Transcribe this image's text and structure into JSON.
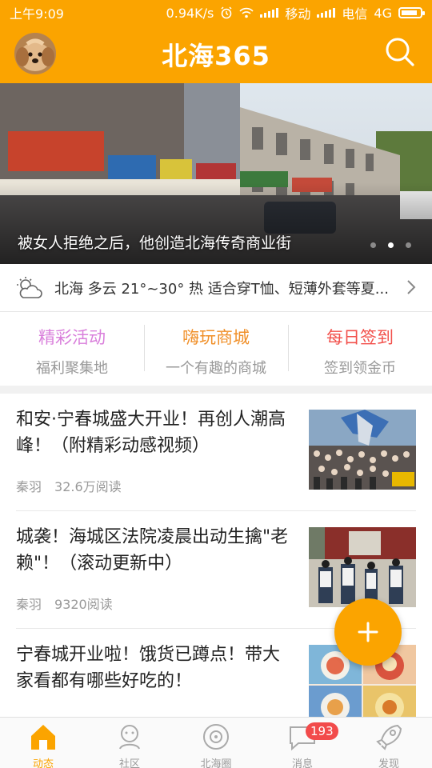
{
  "status_bar": {
    "time": "上午9:09",
    "speed": "0.94K/s",
    "carrier1": "移动",
    "carrier2": "电信",
    "network": "4G",
    "battery_level": 0.85
  },
  "header": {
    "title": "北海365",
    "avatar_icon": "dog-avatar",
    "search_icon": "search-icon"
  },
  "banner": {
    "caption": "被女人拒绝之后，他创造北海传奇商业街",
    "slide_count": 3,
    "active_slide": 2
  },
  "weather": {
    "icon": "cloudy-icon",
    "text": "北海 多云 21°~30° 热 适合穿T恤、短薄外套等夏..."
  },
  "features": [
    {
      "title": "精彩活动",
      "subtitle": "福利聚集地",
      "color": "#d97fdb"
    },
    {
      "title": "嗨玩商城",
      "subtitle": "一个有趣的商城",
      "color": "#f0902a"
    },
    {
      "title": "每日签到",
      "subtitle": "签到领金币",
      "color": "#f2504b"
    }
  ],
  "news": [
    {
      "title": "和安·宁春城盛大开业！再创人潮高峰！（附精彩动感视频）",
      "author": "秦羽",
      "reads": "32.6万阅读"
    },
    {
      "title": "城袭！海城区法院凌晨出动生擒\"老赖\"！（滚动更新中）",
      "author": "秦羽",
      "reads": "9320阅读"
    },
    {
      "title": "宁春城开业啦！饿货已蹲点！带大家看都有哪些好吃的！",
      "author": "",
      "reads": ""
    }
  ],
  "fab": {
    "icon": "plus-icon"
  },
  "tabs": [
    {
      "label": "动态",
      "icon": "home-icon",
      "active": true
    },
    {
      "label": "社区",
      "icon": "community-icon",
      "active": false
    },
    {
      "label": "北海圈",
      "icon": "circle-icon",
      "active": false
    },
    {
      "label": "消息",
      "icon": "message-icon",
      "active": false,
      "badge": "193"
    },
    {
      "label": "发现",
      "icon": "rocket-icon",
      "active": false
    }
  ],
  "colors": {
    "accent": "#fba400",
    "badge": "#f24b4b"
  }
}
